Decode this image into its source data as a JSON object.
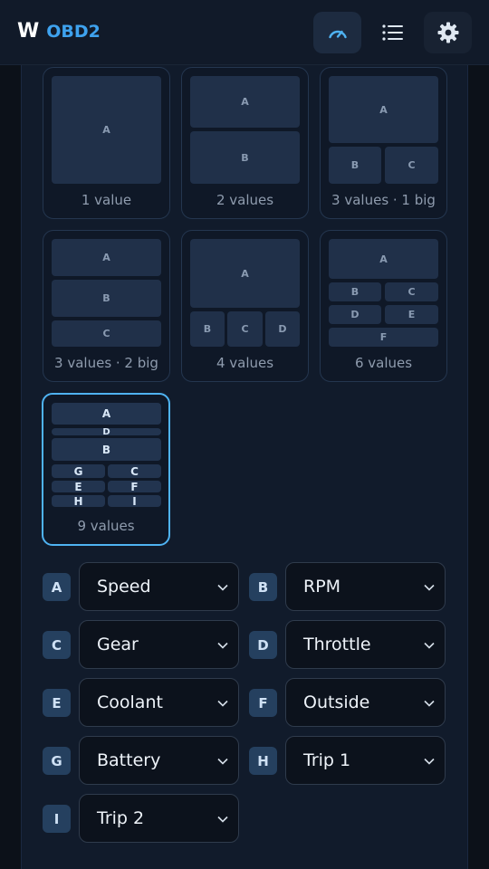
{
  "header": {
    "brand_letter": "W",
    "brand_name": "OBD2"
  },
  "layouts": [
    {
      "label": "1 value",
      "cells": [
        "A"
      ]
    },
    {
      "label": "2 values",
      "cells": [
        "A",
        "B"
      ]
    },
    {
      "label": "3 values · 1 big",
      "cells": [
        "A",
        "B",
        "C"
      ]
    },
    {
      "label": "3 values · 2 big",
      "cells": [
        "A",
        "B",
        "C"
      ]
    },
    {
      "label": "4 values",
      "cells": [
        "A",
        "B",
        "C",
        "D"
      ]
    },
    {
      "label": "6 values",
      "cells": [
        "A",
        "B",
        "C",
        "D",
        "E",
        "F"
      ]
    },
    {
      "label": "9 values",
      "cells": [
        "A",
        "D",
        "B",
        "G",
        "C",
        "E",
        "F",
        "H",
        "I"
      ]
    }
  ],
  "selected_layout": "9 values",
  "assignments": [
    {
      "slot": "A",
      "value": "Speed"
    },
    {
      "slot": "B",
      "value": "RPM"
    },
    {
      "slot": "C",
      "value": "Gear"
    },
    {
      "slot": "D",
      "value": "Throttle"
    },
    {
      "slot": "E",
      "value": "Coolant"
    },
    {
      "slot": "F",
      "value": "Outside"
    },
    {
      "slot": "G",
      "value": "Battery"
    },
    {
      "slot": "H",
      "value": "Trip 1"
    },
    {
      "slot": "I",
      "value": "Trip 2"
    }
  ],
  "colors": {
    "accent": "#4fb3f2",
    "brand": "#3ea2ee",
    "badge": "#25405f"
  },
  "icons": [
    "gauge-icon",
    "list-icon",
    "gear-icon",
    "chevron-down-icon"
  ]
}
